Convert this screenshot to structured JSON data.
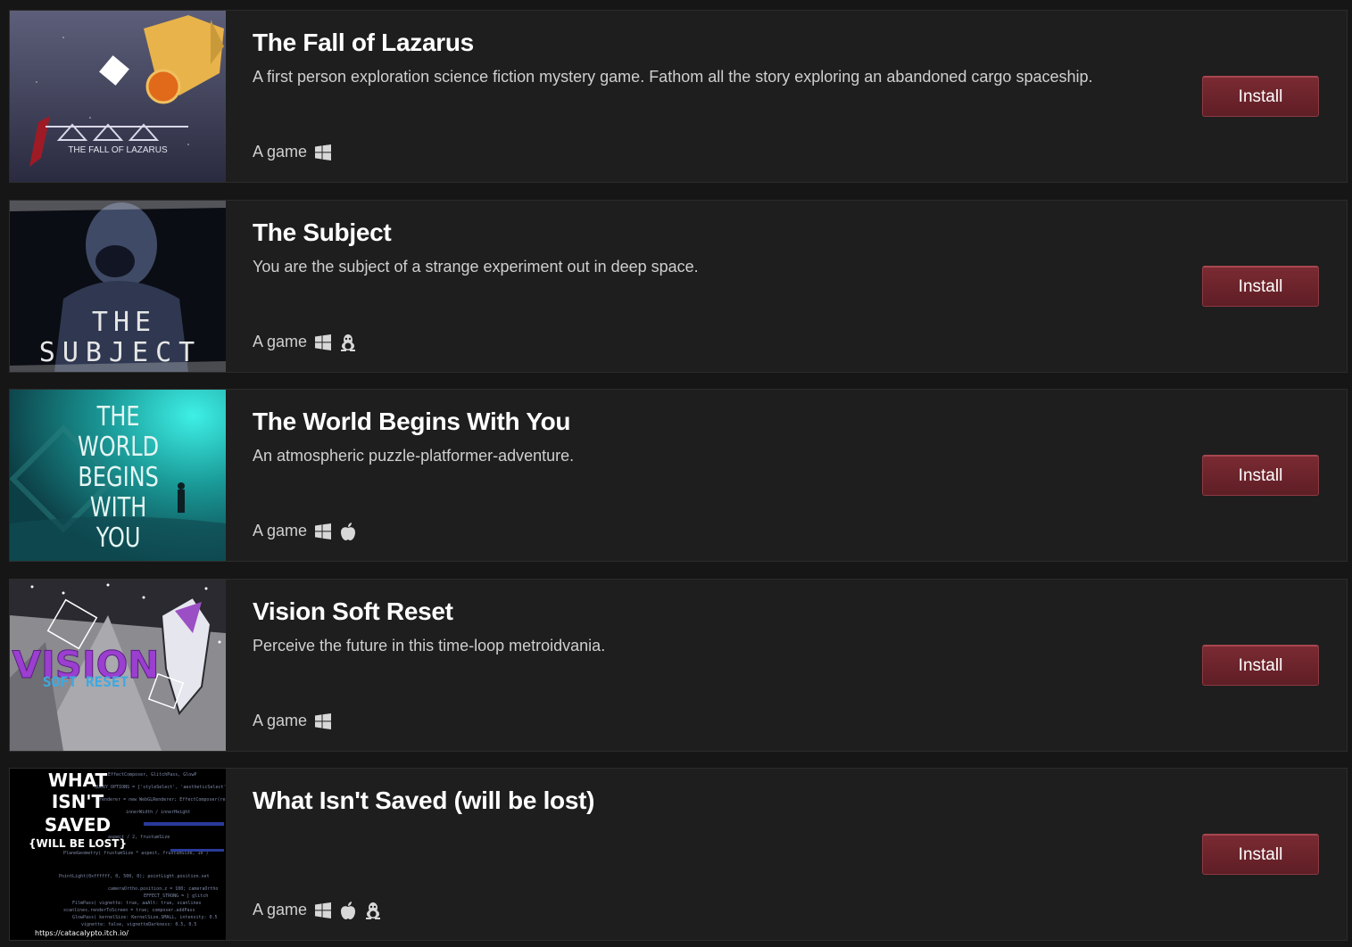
{
  "common": {
    "install_label": "Install",
    "type_label": "A game"
  },
  "games": [
    {
      "title": "The Fall of Lazarus",
      "description": "A first person exploration science fiction mystery game. Fathom all the story exploring an abandoned cargo spaceship.",
      "platforms": [
        "windows-icon"
      ],
      "cover_text": "THE FALL OF LAZARUS"
    },
    {
      "title": "The Subject",
      "description": "You are the subject of a strange experiment out in deep space.",
      "platforms": [
        "windows-icon",
        "linux-icon"
      ],
      "cover_text": "THE SUBJECT"
    },
    {
      "title": "The World Begins With You",
      "description": "An atmospheric puzzle-platformer-adventure.",
      "platforms": [
        "windows-icon",
        "apple-icon"
      ],
      "cover_text": "THE WORLD BEGINS WITH YOU"
    },
    {
      "title": "Vision Soft Reset",
      "description": "Perceive the future in this time-loop metroidvania.",
      "platforms": [
        "windows-icon"
      ],
      "cover_text": "VISION SOFT RESET"
    },
    {
      "title": "What Isn't Saved (will be lost)",
      "description": "",
      "platforms": [
        "windows-icon",
        "apple-icon",
        "linux-icon"
      ],
      "cover_text": "WHAT ISN'T SAVED {WILL BE LOST}",
      "cover_url": "https://catacalypto.itch.io/"
    }
  ],
  "colors": {
    "background": "#161616",
    "card": "#1e1e1e",
    "button": "#6d242c"
  }
}
